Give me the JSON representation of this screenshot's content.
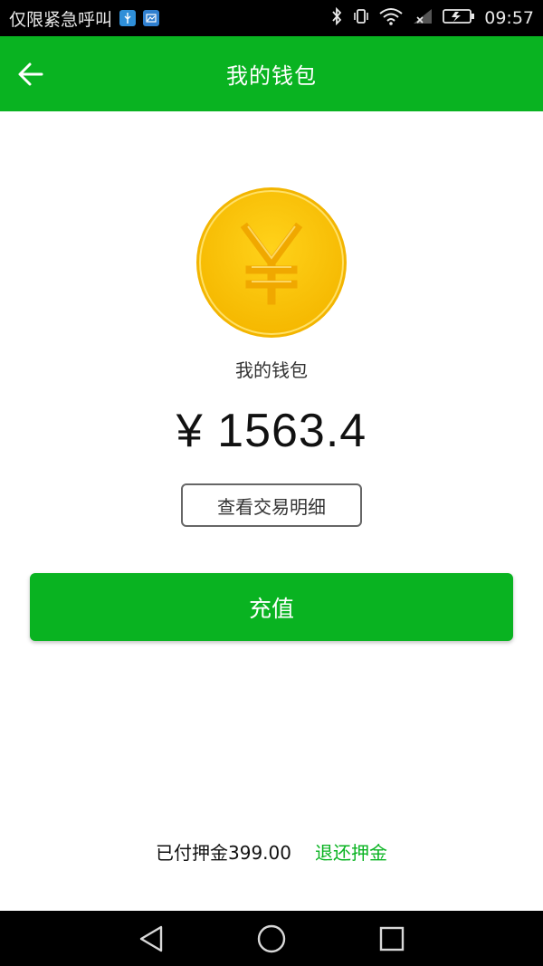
{
  "status_bar": {
    "carrier_text": "仅限紧急呼叫",
    "time": "09:57",
    "icons": [
      "usb-notification-icon",
      "image-notification-icon",
      "bluetooth-icon",
      "vibrate-icon",
      "wifi-icon",
      "no-signal-icon",
      "battery-charging-icon"
    ]
  },
  "app_bar": {
    "title": "我的钱包",
    "back_icon": "arrow-left-icon"
  },
  "wallet": {
    "coin_icon": "yuan-coin-icon",
    "label": "我的钱包",
    "balance": "¥ 1563.4",
    "details_button": "查看交易明细",
    "recharge_button": "充值"
  },
  "deposit": {
    "paid_text": "已付押金399.00",
    "refund_link": "退还押金"
  },
  "nav_bar": {
    "icons": [
      "back-triangle-icon",
      "home-circle-icon",
      "recents-square-icon"
    ]
  },
  "colors": {
    "brand_green": "#09b321",
    "coin_gold": "#f7c400"
  }
}
